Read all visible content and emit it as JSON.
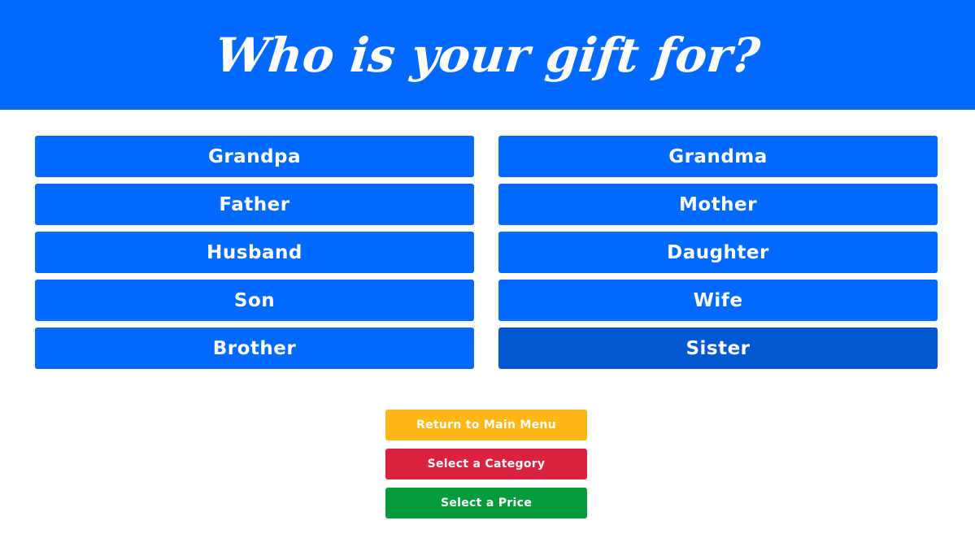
{
  "header": {
    "title": "Who is your gift for?"
  },
  "recipients": {
    "left": [
      "Grandpa",
      "Father",
      "Husband",
      "Son",
      "Brother"
    ],
    "right": [
      "Grandma",
      "Mother",
      "Daughter",
      "Wife",
      "Sister"
    ],
    "active": "Sister"
  },
  "actions": {
    "main_menu_label": "Return to Main Menu",
    "category_label": "Select a Category",
    "price_label": "Select a Price"
  },
  "colors": {
    "primary": "#0169fe",
    "primary_active": "#0158d2",
    "yellow": "#feb716",
    "red": "#db223e",
    "green": "#039b3c"
  }
}
